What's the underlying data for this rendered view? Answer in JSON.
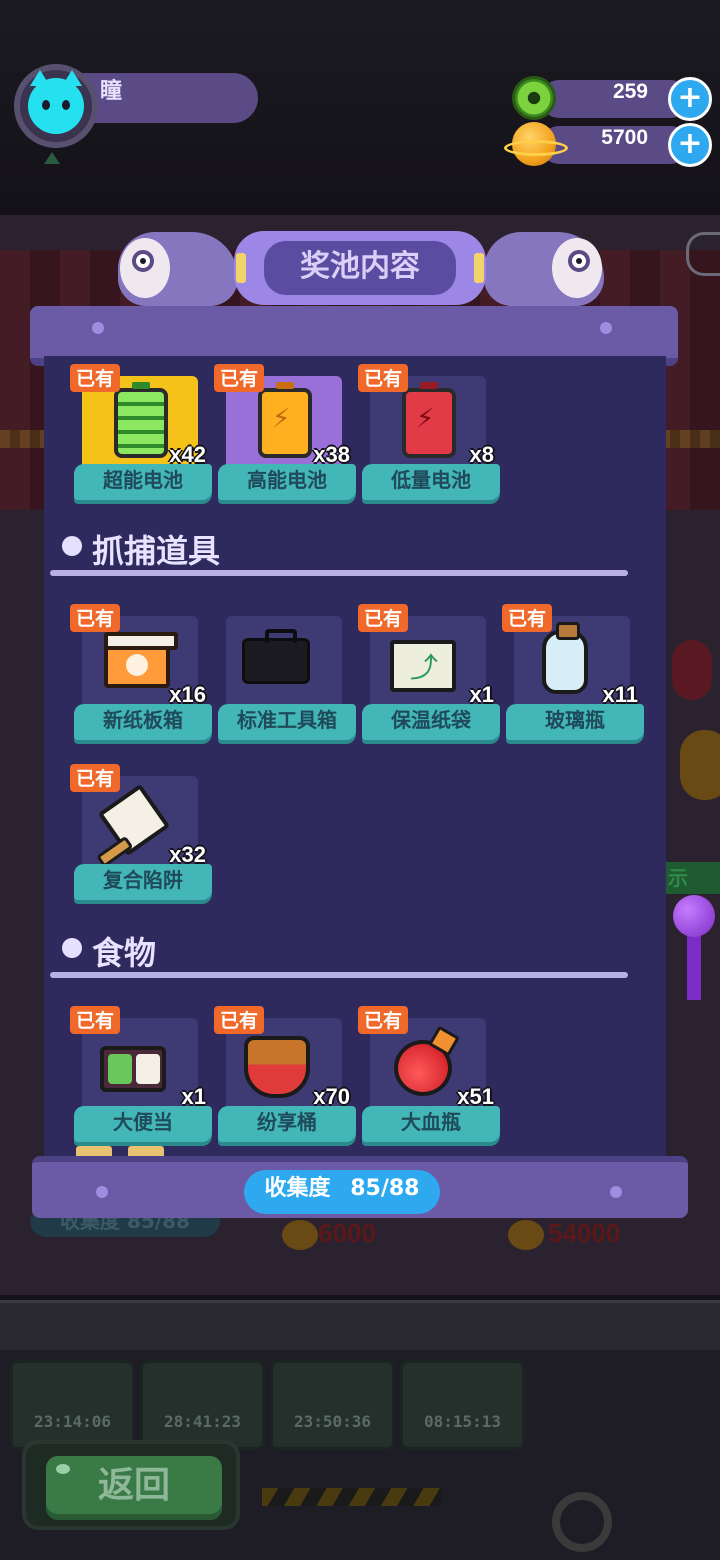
{
  "player": {
    "name": "瞳"
  },
  "currency": {
    "gems": "259",
    "coins": "5700"
  },
  "popup": {
    "title": "奖池内容",
    "top_items": [
      {
        "badge": "已有",
        "count": "x42",
        "name": "超能电池"
      },
      {
        "badge": "已有",
        "count": "x38",
        "name": "高能电池"
      },
      {
        "badge": "已有",
        "count": "x8",
        "name": "低量电池"
      }
    ],
    "sections": [
      {
        "title": "抓捕道具",
        "items": [
          {
            "badge": "已有",
            "count": "x16",
            "name": "新纸板箱"
          },
          {
            "badge": "",
            "count": "",
            "name": "标准工具箱"
          },
          {
            "badge": "已有",
            "count": "x1",
            "name": "保温纸袋"
          },
          {
            "badge": "已有",
            "count": "x11",
            "name": "玻璃瓶"
          },
          {
            "badge": "已有",
            "count": "x32",
            "name": "复合陷阱"
          }
        ]
      },
      {
        "title": "食物",
        "items": [
          {
            "badge": "已有",
            "count": "x1",
            "name": "大便当"
          },
          {
            "badge": "已有",
            "count": "x70",
            "name": "纷享桶"
          },
          {
            "badge": "已有",
            "count": "x51",
            "name": "大血瓶"
          }
        ]
      }
    ],
    "collection": {
      "label": "收集度",
      "value": "85/88"
    }
  },
  "background": {
    "collection_label": "收集度 85/88",
    "price_1": "6000",
    "price_2": "54000",
    "timers": [
      "23:14:06",
      "28:41:23",
      "23:50:36",
      "08:15:13"
    ],
    "side_text": "示"
  },
  "back_button": {
    "label": "返回"
  }
}
